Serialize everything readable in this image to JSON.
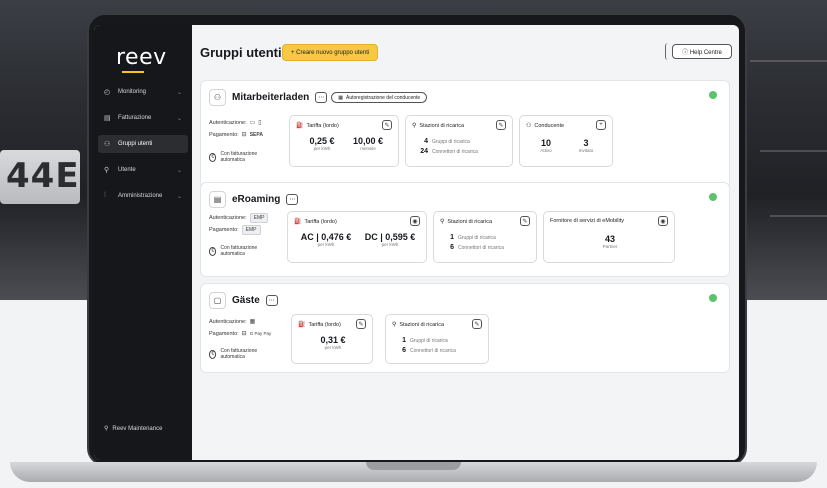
{
  "background": {
    "plate_text": "44E"
  },
  "app": {
    "logo": "reev",
    "page_title": "Gruppi utenti",
    "create_button": "+ Creare nuovo gruppo utenti",
    "help_button": "ⓘ Help Centre",
    "accent_color": "#f7c843",
    "status_color": "#5cc26b"
  },
  "sidebar": {
    "items": [
      {
        "label": "Monitoring",
        "icon": "monitor-icon"
      },
      {
        "label": "Fatturazione",
        "icon": "invoice-icon"
      },
      {
        "label": "Gruppi utenti",
        "icon": "group-icon",
        "active": true
      },
      {
        "label": "Utente",
        "icon": "user-icon"
      },
      {
        "label": "Amministrazione",
        "icon": "settings-sliders-icon"
      }
    ],
    "footer": "Reev Maintenance"
  },
  "cards": [
    {
      "title": "Mitarbeiterladen",
      "pill": "Autoregistrazione del conducente",
      "auth_label": "Autenticazione:",
      "pay_label": "Pagamento:",
      "pay_value": "SEPA",
      "billing": "Con fatturazione automatica",
      "tariff": {
        "title": "Tariffa (lordo)",
        "v1": "0,25 €",
        "u1": "per kWh",
        "v2": "10,00 €",
        "u2": "mensile"
      },
      "stations": {
        "title": "Stazioni di ricarica",
        "n1": "4",
        "l1": "Gruppi di ricarica",
        "n2": "24",
        "l2": "Connettori di ricarica"
      },
      "drivers": {
        "title": "Conducente",
        "v1": "10",
        "l1": "Attivo",
        "v2": "3",
        "l2": "Invitato"
      }
    },
    {
      "title": "eRoaming",
      "auth_label": "Autenticazione:",
      "auth_value": "EMP",
      "pay_label": "Pagamento:",
      "pay_value": "EMP",
      "billing": "Con fatturazione automatica",
      "tariff": {
        "title": "Tariffa (lordo)",
        "v1": "AC | 0,476 €",
        "u1": "per kWh",
        "v2": "DC | 0,595 €",
        "u2": "per kWh"
      },
      "stations": {
        "title": "Stazioni di ricarica",
        "n1": "1",
        "l1": "Gruppi di ricarica",
        "n2": "6",
        "l2": "Connettori di ricarica"
      },
      "providers": {
        "title": "Fornitore di servizi di eMobility",
        "v1": "43",
        "l1": "Partner"
      }
    },
    {
      "title": "Gäste",
      "auth_label": "Autenticazione:",
      "pay_label": "Pagamento:",
      "pay_value": "G Pay  Pay",
      "billing": "Con fatturazione automatica",
      "tariff": {
        "title": "Tariffa (lordo)",
        "v1": "0,31 €",
        "u1": "per kWh"
      },
      "stations": {
        "title": "Stazioni di ricarica",
        "n1": "1",
        "l1": "Gruppi di ricarica",
        "n2": "6",
        "l2": "Connettori di ricarica"
      }
    }
  ]
}
